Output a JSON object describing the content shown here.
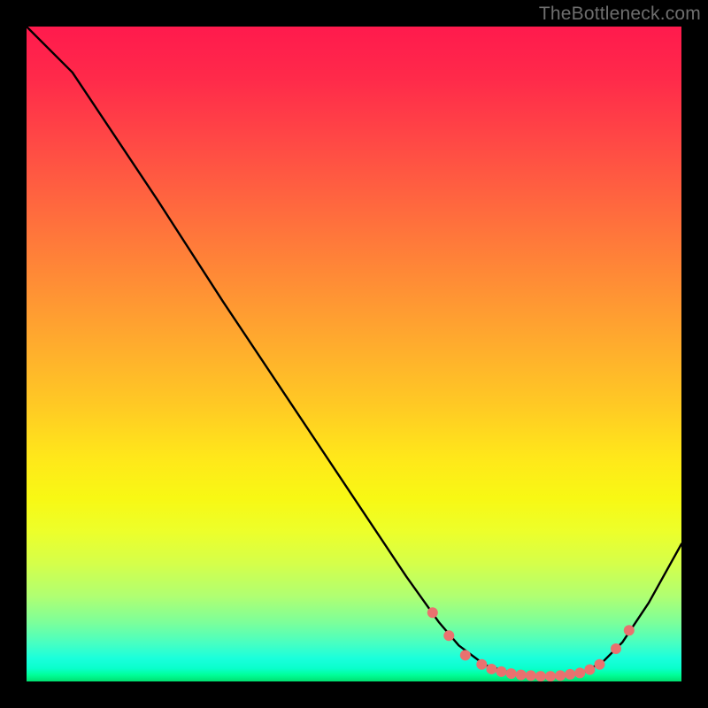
{
  "attribution": "TheBottleneck.com",
  "chart_data": {
    "type": "line",
    "title": "",
    "xlabel": "",
    "ylabel": "",
    "xlim": [
      0,
      100
    ],
    "ylim": [
      0,
      100
    ],
    "background": {
      "style": "vertical-gradient",
      "top_color": "#ff1a4d",
      "bottom_color": "#00e070",
      "stops": [
        "red",
        "orange",
        "yellow",
        "green"
      ]
    },
    "curve": {
      "description": "V-shaped bottleneck curve; steep descent from upper-left to a flat minimum band near x≈70-88, then rising toward the right edge.",
      "points": [
        {
          "x": 0.0,
          "y": 100.0
        },
        {
          "x": 7.0,
          "y": 93.0
        },
        {
          "x": 10.0,
          "y": 88.5
        },
        {
          "x": 20.0,
          "y": 73.5
        },
        {
          "x": 30.0,
          "y": 58.0
        },
        {
          "x": 40.0,
          "y": 43.0
        },
        {
          "x": 50.0,
          "y": 28.0
        },
        {
          "x": 58.0,
          "y": 16.0
        },
        {
          "x": 63.0,
          "y": 9.0
        },
        {
          "x": 66.0,
          "y": 5.5
        },
        {
          "x": 70.0,
          "y": 2.5
        },
        {
          "x": 75.0,
          "y": 1.0
        },
        {
          "x": 80.0,
          "y": 0.8
        },
        {
          "x": 85.0,
          "y": 1.4
        },
        {
          "x": 88.0,
          "y": 3.0
        },
        {
          "x": 91.0,
          "y": 6.0
        },
        {
          "x": 95.0,
          "y": 12.0
        },
        {
          "x": 100.0,
          "y": 21.0
        }
      ]
    },
    "markers": {
      "color": "#e9716f",
      "radius_px": 6,
      "points": [
        {
          "x": 62.0,
          "y": 10.5
        },
        {
          "x": 64.5,
          "y": 7.0
        },
        {
          "x": 67.0,
          "y": 4.0
        },
        {
          "x": 69.5,
          "y": 2.6
        },
        {
          "x": 71.0,
          "y": 1.9
        },
        {
          "x": 72.5,
          "y": 1.5
        },
        {
          "x": 74.0,
          "y": 1.2
        },
        {
          "x": 75.5,
          "y": 1.0
        },
        {
          "x": 77.0,
          "y": 0.9
        },
        {
          "x": 78.5,
          "y": 0.8
        },
        {
          "x": 80.0,
          "y": 0.8
        },
        {
          "x": 81.5,
          "y": 0.9
        },
        {
          "x": 83.0,
          "y": 1.1
        },
        {
          "x": 84.5,
          "y": 1.3
        },
        {
          "x": 86.0,
          "y": 1.8
        },
        {
          "x": 87.5,
          "y": 2.6
        },
        {
          "x": 90.0,
          "y": 5.0
        },
        {
          "x": 92.0,
          "y": 7.8
        }
      ]
    }
  }
}
